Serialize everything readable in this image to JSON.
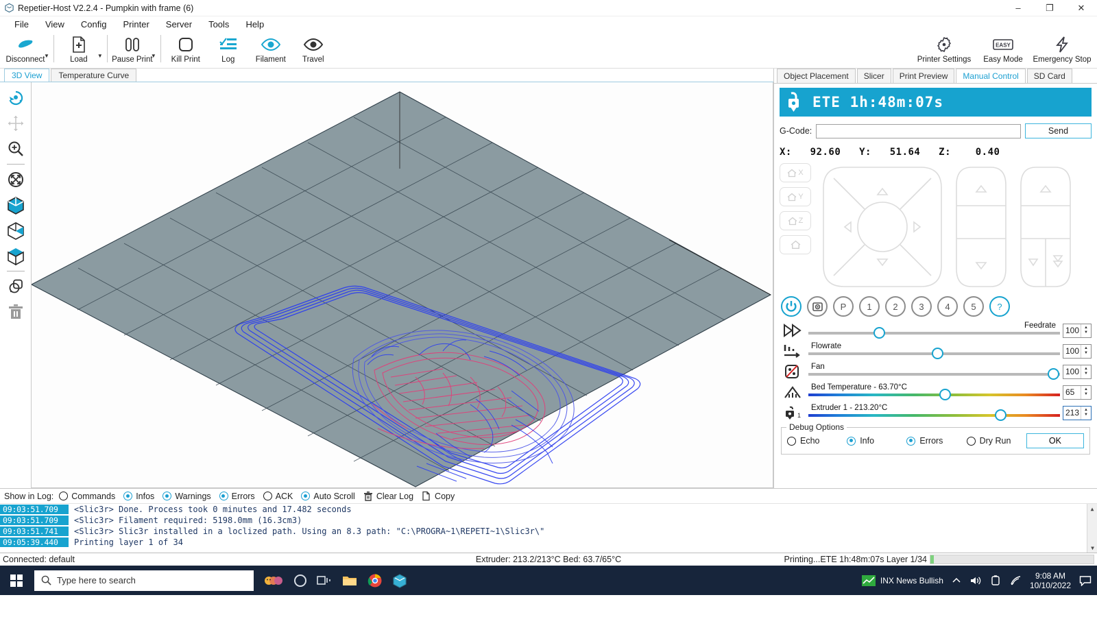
{
  "window": {
    "title": "Repetier-Host V2.2.4 - Pumpkin with frame (6)",
    "app_icon": "repetier-cube-icon",
    "minimize": "–",
    "maximize": "❐",
    "close": "✕"
  },
  "menu": [
    "File",
    "View",
    "Config",
    "Printer",
    "Server",
    "Tools",
    "Help"
  ],
  "toolbar": {
    "left": [
      {
        "label": "Disconnect",
        "icon": "plug-disconnect-icon",
        "caret": true
      },
      {
        "label": "Load",
        "icon": "file-add-icon",
        "caret": true
      },
      {
        "label": "Pause Print",
        "icon": "pause-icon",
        "caret": true
      },
      {
        "label": "Kill Print",
        "icon": "stop-square-icon",
        "caret": false
      },
      {
        "label": "Log",
        "icon": "log-list-icon",
        "caret": false
      },
      {
        "label": "Filament",
        "icon": "eye-filament-icon",
        "caret": false
      },
      {
        "label": "Travel",
        "icon": "eye-travel-icon",
        "caret": false
      }
    ],
    "right": [
      {
        "label": "Printer Settings",
        "icon": "gear-icon"
      },
      {
        "label": "Easy Mode",
        "icon": "easy-badge-icon"
      },
      {
        "label": "Emergency Stop",
        "icon": "lightning-bolt-icon"
      }
    ]
  },
  "view_tabs": [
    {
      "label": "3D View",
      "active": true
    },
    {
      "label": "Temperature Curve",
      "active": false
    }
  ],
  "left_tools": [
    {
      "name": "rotate-view-tool",
      "icon": "rotate-icon",
      "accent": true
    },
    {
      "name": "move-view-tool",
      "icon": "move-arrows-icon",
      "accent": false
    },
    {
      "name": "zoom-view-tool",
      "icon": "magnifier-plus-icon",
      "accent": false
    },
    {
      "name": "scale-fit-tool",
      "icon": "arrows-expand-circle-icon",
      "accent": false
    },
    {
      "name": "view-mode-solid",
      "icon": "cube-solid-icon",
      "accent": true
    },
    {
      "name": "view-mode-transparent",
      "icon": "cube-half-icon",
      "accent": true
    },
    {
      "name": "view-mode-wireframe",
      "icon": "cube-open-icon",
      "accent": true
    },
    {
      "name": "copy-object-tool",
      "icon": "copy-objects-icon",
      "accent": false
    },
    {
      "name": "delete-object-tool",
      "icon": "trash-icon",
      "accent": false
    }
  ],
  "right_tabs": [
    {
      "label": "Object Placement",
      "active": false
    },
    {
      "label": "Slicer",
      "active": false
    },
    {
      "label": "Print Preview",
      "active": false
    },
    {
      "label": "Manual Control",
      "active": true
    },
    {
      "label": "SD Card",
      "active": false
    }
  ],
  "manual_control": {
    "ete_icon": "printer-plug-icon",
    "ete_text": "ETE 1h:48m:07s",
    "gcode_label": "G-Code:",
    "gcode_value": "",
    "gcode_placeholder": "",
    "send_label": "Send",
    "coords": "X:   92.60   Y:   51.64   Z:    0.40",
    "home_buttons": [
      {
        "label": "X",
        "name": "home-x-button"
      },
      {
        "label": "Y",
        "name": "home-y-button"
      },
      {
        "label": "Z",
        "name": "home-z-button"
      },
      {
        "label": "",
        "name": "home-all-button"
      }
    ],
    "action_buttons": [
      {
        "label": "",
        "name": "power-toggle-button",
        "icon": "power-icon",
        "accent": true
      },
      {
        "label": "",
        "name": "webcam-button",
        "icon": "camera-icon",
        "accent": false
      },
      {
        "label": "P",
        "name": "park-button",
        "accent": false
      },
      {
        "label": "1",
        "name": "script-1-button",
        "accent": false
      },
      {
        "label": "2",
        "name": "script-2-button",
        "accent": false
      },
      {
        "label": "3",
        "name": "script-3-button",
        "accent": false
      },
      {
        "label": "4",
        "name": "script-4-button",
        "accent": false
      },
      {
        "label": "5",
        "name": "script-5-button",
        "accent": false
      },
      {
        "label": "?",
        "name": "help-button",
        "accent": true
      }
    ],
    "sliders": [
      {
        "name": "feedrate-slider",
        "label": "Feedrate",
        "label_right": true,
        "value": "100",
        "pct": 27,
        "type": "plain",
        "icon": "fast-forward-icon"
      },
      {
        "name": "flowrate-slider",
        "label": "Flowrate",
        "label_right": false,
        "value": "100",
        "pct": 50,
        "type": "plain",
        "icon": "flowrate-icon"
      },
      {
        "name": "fan-slider",
        "label": "Fan",
        "label_right": false,
        "value": "100",
        "pct": 100,
        "type": "plain",
        "icon": "fan-off-icon"
      },
      {
        "name": "bed-temperature-slider",
        "label": "Bed Temperature - 63.70°C",
        "label_right": false,
        "value": "65",
        "pct": 53,
        "type": "temp",
        "icon": "heated-bed-icon"
      },
      {
        "name": "extruder-1-temperature-slider",
        "label": "Extruder 1 - 213.20°C",
        "label_right": false,
        "value": "213",
        "pct": 75,
        "type": "temp",
        "icon": "extruder-icon",
        "focused": true
      }
    ],
    "debug": {
      "legend": "Debug Options",
      "options": [
        {
          "label": "Echo",
          "on": false
        },
        {
          "label": "Info",
          "on": true
        },
        {
          "label": "Errors",
          "on": true
        },
        {
          "label": "Dry Run",
          "on": false
        }
      ],
      "ok_label": "OK"
    }
  },
  "log": {
    "show_label": "Show in Log:",
    "filters": [
      {
        "label": "Commands",
        "on": false
      },
      {
        "label": "Infos",
        "on": true
      },
      {
        "label": "Warnings",
        "on": true
      },
      {
        "label": "Errors",
        "on": true
      },
      {
        "label": "ACK",
        "on": false
      },
      {
        "label": "Auto Scroll",
        "on": true
      }
    ],
    "clear_label": "Clear Log",
    "copy_label": "Copy",
    "lines": [
      {
        "ts": "09:03:51.709",
        "msg": "<Slic3r> Done. Process took 0 minutes and 17.482 seconds"
      },
      {
        "ts": "09:03:51.709",
        "msg": "<Slic3r> Filament required: 5198.0mm (16.3cm3)"
      },
      {
        "ts": "09:03:51.741",
        "msg": "<Slic3r> Slic3r installed in a loclized path. Using an 8.3 path: \"C:\\PROGRA~1\\REPETI~1\\Slic3r\\\""
      },
      {
        "ts": "09:05:39.440",
        "msg": "Printing layer 1 of 34"
      }
    ]
  },
  "statusbar": {
    "left": "Connected: default",
    "middle": "Extruder: 213.2/213°C Bed: 63.7/65°C",
    "right": "Printing...ETE 1h:48m:07s Layer 1/34",
    "progress_pct": 2
  },
  "taskbar": {
    "search_placeholder": "Type here to search",
    "apps": [
      {
        "name": "cortana-icon"
      },
      {
        "name": "task-view-icon"
      },
      {
        "name": "file-explorer-icon"
      },
      {
        "name": "chrome-icon"
      },
      {
        "name": "repetier-host-icon"
      }
    ],
    "news_label": "INX  News Bullish",
    "time": "9:08 AM",
    "date": "10/10/2022"
  },
  "colors": {
    "accent": "#17a3cf",
    "bed": "#8b9ba1",
    "perimeter": "#2b3df0",
    "infill": "#e0407a",
    "taskbar": "#17253b"
  }
}
